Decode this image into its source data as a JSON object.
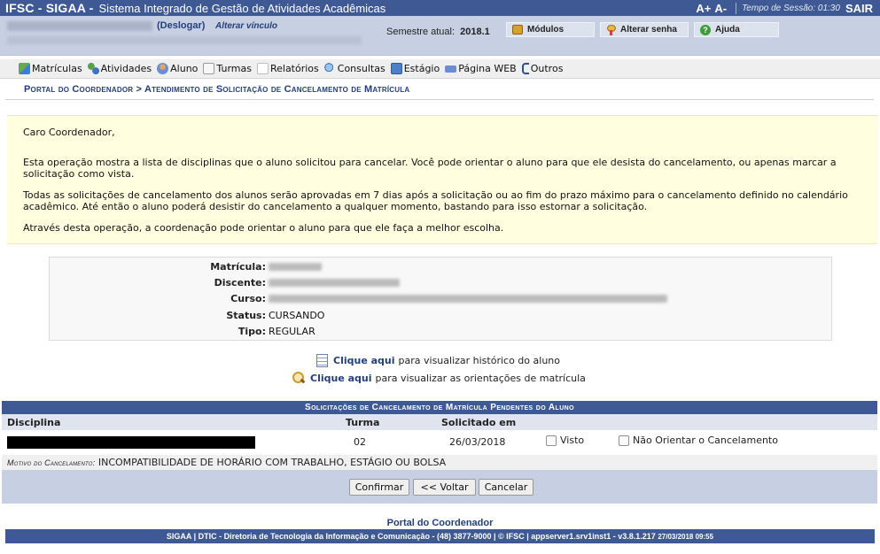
{
  "header": {
    "brand": "IFSC - SIGAA -",
    "subtitle": "Sistema Integrado de Gestão de Atividades Acadêmicas",
    "font_increase": "A+",
    "font_decrease": "A-",
    "session_label": "Tempo de Sessão: 01:30",
    "logout": "SAIR"
  },
  "userbar": {
    "deslogar": "(Deslogar)",
    "alterar_vinculo": "Alterar vínculo",
    "semestre_label": "Semestre atual:",
    "semestre_value": "2018.1",
    "buttons": {
      "modulos": "Módulos",
      "alterar_senha": "Alterar senha",
      "ajuda": "Ajuda"
    }
  },
  "menu": [
    {
      "label": "Matrículas",
      "icon": "matriculas-icon"
    },
    {
      "label": "Atividades",
      "icon": "atividades-icon"
    },
    {
      "label": "Aluno",
      "icon": "aluno-icon"
    },
    {
      "label": "Turmas",
      "icon": "turmas-icon"
    },
    {
      "label": "Relatórios",
      "icon": "relatorios-icon"
    },
    {
      "label": "Consultas",
      "icon": "consultas-icon"
    },
    {
      "label": "Estágio",
      "icon": "estagio-icon"
    },
    {
      "label": "Página WEB",
      "icon": "pagina-web-icon"
    },
    {
      "label": "Outros",
      "icon": "outros-icon"
    }
  ],
  "breadcrumb": "Portal do Coordenador > Atendimento de Solicitação de Cancelamento de Matrícula",
  "info": {
    "greeting": "Caro Coordenador,",
    "p1": "Esta operação mostra a lista de disciplinas que o aluno solicitou para cancelar. Você pode orientar o aluno para que ele desista do cancelamento, ou apenas marcar a solicitação como vista.",
    "p2": "Todas as solicitações de cancelamento dos alunos serão aprovadas em 7 dias após a solicitação ou ao fim do prazo máximo para o cancelamento definido no calendário acadêmico. Até então o aluno poderá desistir do cancelamento a qualquer momento, bastando para isso estornar a solicitação.",
    "p3": "Através desta operação, a coordenação pode orientar o aluno para que ele faça a melhor escolha."
  },
  "details": {
    "matricula_label": "Matrícula:",
    "discente_label": "Discente:",
    "curso_label": "Curso:",
    "status_label": "Status:",
    "status_value": "CURSANDO",
    "tipo_label": "Tipo:",
    "tipo_value": "REGULAR"
  },
  "links": {
    "historico_link": "Clique aqui",
    "historico_text": "para visualizar histórico do aluno",
    "orientacoes_link": "Clique aqui",
    "orientacoes_text": "para visualizar as orientações de matrícula"
  },
  "table": {
    "title": "Solicitações de Cancelamento de Matrícula Pendentes do Aluno",
    "headers": {
      "disciplina": "Disciplina",
      "turma": "Turma",
      "solicitado": "Solicitado em"
    },
    "row": {
      "turma": "02",
      "solicitado": "26/03/2018",
      "visto_label": "Visto",
      "nao_orientar_label": "Não Orientar o Cancelamento"
    },
    "motivo_label": "Motivo do Cancelamento:",
    "motivo_value": "INCOMPATIBILIDADE DE HORÁRIO COM TRABALHO, ESTÁGIO OU BOLSA",
    "buttons": {
      "confirmar": "Confirmar",
      "voltar": "<< Voltar",
      "cancelar": "Cancelar"
    }
  },
  "footer": {
    "portal_link": "Portal do Coordenador",
    "text": "SIGAA | DTIC - Diretoria de Tecnologia da Informação e Comunicação - (48) 3877-9000 | © IFSC | appserver1.srv1inst1 - v3.8.1.217",
    "timestamp": "27/03/2018 09:55"
  }
}
